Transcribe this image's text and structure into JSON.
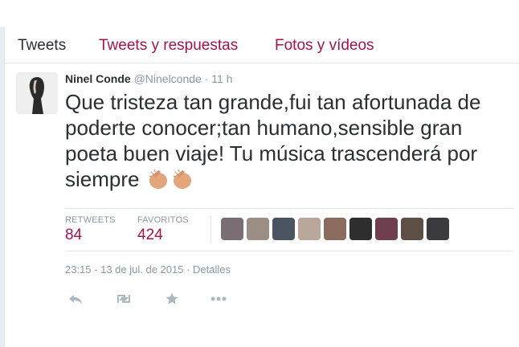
{
  "tabs": [
    "Tweets",
    "Tweets y respuestas",
    "Fotos y vídeos"
  ],
  "tweet": {
    "fullname": "Ninel Conde",
    "username": "@Ninelconde",
    "dot": "·",
    "time": "11 h",
    "text": "Que tristeza tan grande,fui tan afortunada de poderte conocer;tan humano,sensible gran poeta buen viaje! Tu música trascenderá por siempre",
    "retweets_label": "RETWEETS",
    "retweets_value": "84",
    "favorites_label": "FAVORITOS",
    "favorites_value": "424",
    "timestamp": "23:15 - 13 de jul. de 2015",
    "separator": "·",
    "details": "Detalles"
  },
  "icons": {
    "avatar": "avatar-image",
    "reply": "reply-icon",
    "retweet": "retweet-icon",
    "favorite": "star-icon",
    "more": "more-icon",
    "clap": "clapping-hands-icon"
  },
  "colors": {
    "accent": "#a0144e",
    "muted": "#8899a6",
    "text": "#292f33",
    "border": "#e1e8ed"
  }
}
